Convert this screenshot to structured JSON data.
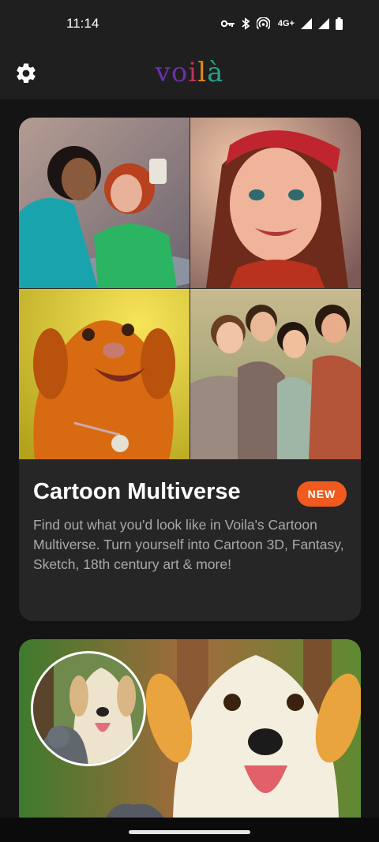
{
  "status_bar": {
    "time": "11:14",
    "network": "4G+",
    "icons": [
      "key-icon",
      "bluetooth-icon",
      "hotspot-icon",
      "signal-icon",
      "hd-signal-icon",
      "battery-icon"
    ]
  },
  "header": {
    "logo": {
      "parts": [
        "vo",
        "i",
        "l",
        "à"
      ]
    },
    "settings_icon": "gear-icon"
  },
  "feed": {
    "cards": [
      {
        "title": "Cartoon Multiverse",
        "badge": "NEW",
        "description": "Find out what you'd look like in Voila's Cartoon Multiverse. Turn yourself into Cartoon 3D, Fantasy, Sketch, 18th century art & more!",
        "images": [
          "two-women-cartoon",
          "woman-red-bandana-cartoon",
          "golden-dog-cartoon",
          "family-cartoon"
        ]
      },
      {
        "images": [
          "dog-and-cat-photo-inset",
          "cartoon-puppy"
        ]
      }
    ]
  },
  "colors": {
    "accent": "#f05a1e",
    "background": "#141414",
    "card": "#262626",
    "bar": "#1f1f1f"
  }
}
